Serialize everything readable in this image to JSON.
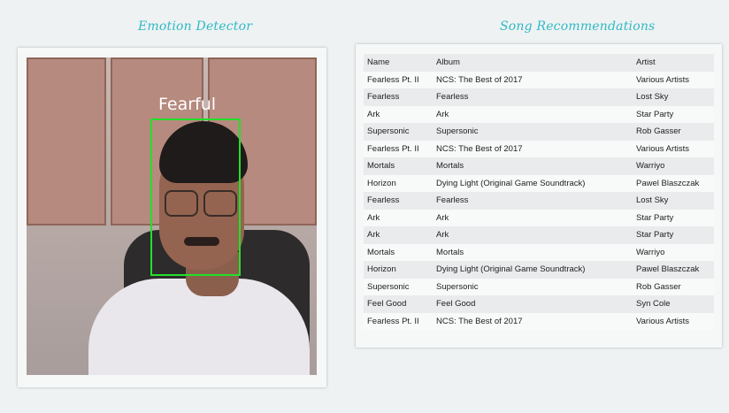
{
  "header": {
    "emotion_title": "Emotion Detector",
    "songs_title": "Song Recommendations"
  },
  "camera": {
    "emotion_label": "Fearful",
    "box_color": "#23e02a"
  },
  "table": {
    "headers": [
      "Name",
      "Album",
      "Artist"
    ],
    "rows": [
      [
        "Fearless Pt. II",
        "NCS: The Best of 2017",
        "Various Artists"
      ],
      [
        "Fearless",
        "Fearless",
        "Lost Sky"
      ],
      [
        "Ark",
        "Ark",
        "Star Party"
      ],
      [
        "Supersonic",
        "Supersonic",
        "Rob Gasser"
      ],
      [
        "Fearless Pt. II",
        "NCS: The Best of 2017",
        "Various Artists"
      ],
      [
        "Mortals",
        "Mortals",
        "Warriyo"
      ],
      [
        "Horizon",
        "Dying Light (Original Game Soundtrack)",
        "Pawel Blaszczak"
      ],
      [
        "Fearless",
        "Fearless",
        "Lost Sky"
      ],
      [
        "Ark",
        "Ark",
        "Star Party"
      ],
      [
        "Ark",
        "Ark",
        "Star Party"
      ],
      [
        "Mortals",
        "Mortals",
        "Warriyo"
      ],
      [
        "Horizon",
        "Dying Light (Original Game Soundtrack)",
        "Pawel Blaszczak"
      ],
      [
        "Supersonic",
        "Supersonic",
        "Rob Gasser"
      ],
      [
        "Feel Good",
        "Feel Good",
        "Syn Cole"
      ],
      [
        "Fearless Pt. II",
        "NCS: The Best of 2017",
        "Various Artists"
      ]
    ]
  },
  "colors": {
    "accent": "#2fb9c6",
    "background": "#eef2f2"
  }
}
